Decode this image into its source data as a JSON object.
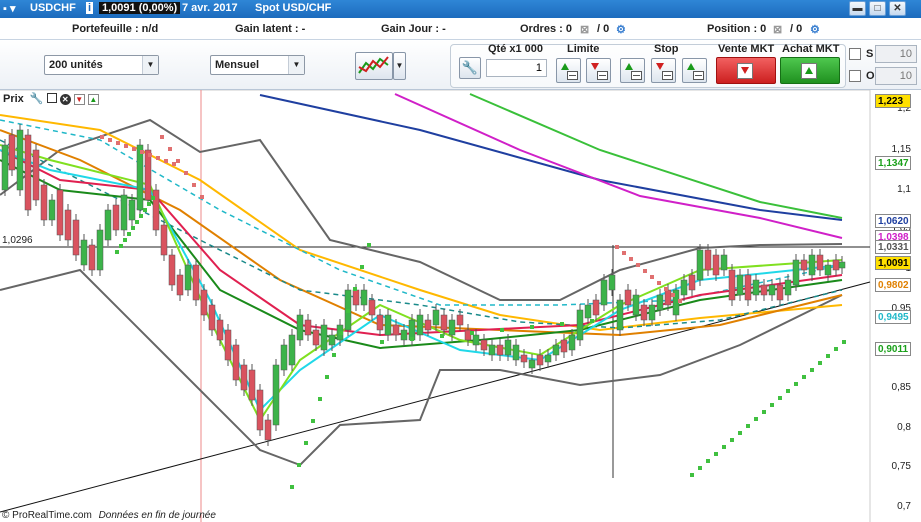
{
  "titlebar": {
    "symbol": "USDCHF",
    "price": "1,0091 (0,00%)",
    "date": "7 avr. 2017",
    "market": "Spot USD/CHF"
  },
  "info": {
    "portefeuille": "Portefeuille : n/d",
    "gain_latent": "Gain latent : -",
    "gain_jour": "Gain Jour : -",
    "ordres": "Ordres : 0",
    "ordres_sep": "/ 0",
    "position": "Position : 0",
    "position_sep": "/ 0"
  },
  "toolbar": {
    "quantity_select": "200 unités",
    "period_select": "Mensuel",
    "qty_label": "Qté x1 000",
    "qty_value": "1",
    "limite_label": "Limite",
    "stop_label": "Stop",
    "sell_label": "Vente MKT",
    "buy_label": "Achat MKT",
    "s_label": "S",
    "o_label": "O",
    "s_value": "10",
    "o_value": "10"
  },
  "chart": {
    "panel_label": "Prix",
    "hline_label": "1,0296",
    "footer_brand": "© ProRealTime.com",
    "footer_note": "Données en fin de journée",
    "axis_ticks": [
      "1,2",
      "1,15",
      "1,1",
      "1,05",
      "1",
      "0,95",
      "0,9",
      "0,85",
      "0,8",
      "0,75",
      "0,7"
    ],
    "price_tags": [
      {
        "text": "1,223",
        "bg": "#ffe000",
        "color": "#000"
      },
      {
        "text": "1,1347",
        "bg": "#fff",
        "color": "#1aa01a"
      },
      {
        "text": "1,0620",
        "bg": "#fff",
        "color": "#1f3fa0"
      },
      {
        "text": "1,0398",
        "bg": "#fff",
        "color": "#d020c8"
      },
      {
        "text": "1,0331",
        "bg": "#fff",
        "color": "#555"
      },
      {
        "text": "1,0091",
        "bg": "#ffe000",
        "color": "#000"
      },
      {
        "text": "0,9802",
        "bg": "#fff",
        "color": "#e08000"
      },
      {
        "text": "0,9495",
        "bg": "#fff",
        "color": "#20b8c8"
      },
      {
        "text": "0,9011",
        "bg": "#fff",
        "color": "#1aa01a"
      }
    ]
  },
  "colors": {
    "title_bg": "#1c6bbd",
    "sell": "#e03030",
    "buy": "#2aa02a",
    "up_candle": "#3cb34a",
    "down_candle": "#d9535f"
  }
}
